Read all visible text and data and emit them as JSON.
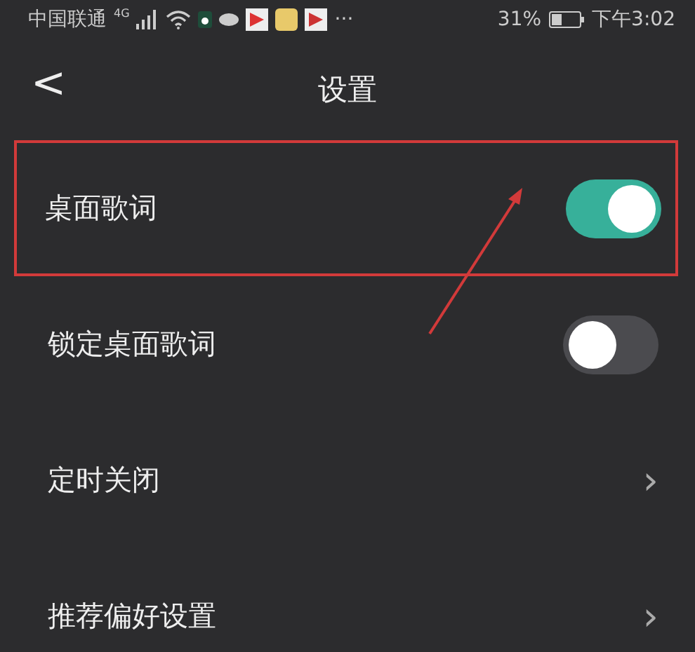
{
  "status_bar": {
    "carrier": "中国联通",
    "network": "4G",
    "more": "···",
    "battery": "31%",
    "time": "下午3:02"
  },
  "header": {
    "back": "<",
    "title": "设置"
  },
  "settings": [
    {
      "kind": "toggle",
      "label": "桌面歌词",
      "on": true,
      "highlighted": true
    },
    {
      "kind": "toggle",
      "label": "锁定桌面歌词",
      "on": false,
      "highlighted": false
    },
    {
      "kind": "link",
      "label": "定时关闭",
      "chevron": "›"
    },
    {
      "kind": "link",
      "label": "推荐偏好设置",
      "chevron": "›"
    }
  ]
}
